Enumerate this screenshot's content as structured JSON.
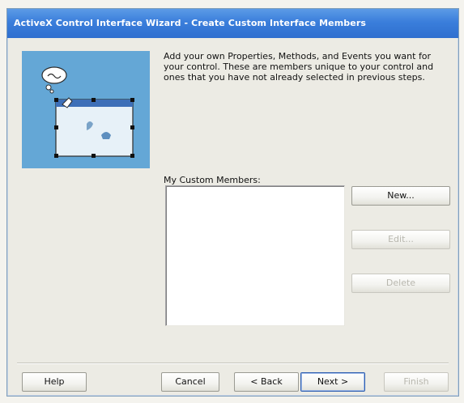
{
  "window": {
    "title": "ActiveX Control Interface Wizard - Create Custom Interface Members"
  },
  "art": {
    "icon": "wizard-illustration"
  },
  "description": "Add your own Properties, Methods, and Events you want for your control.  These are members unique to your control and ones that you have not already selected in previous steps.",
  "members": {
    "label": "My Custom Members:",
    "items": []
  },
  "buttons": {
    "new": "New...",
    "edit": "Edit...",
    "delete": "Delete",
    "help": "Help",
    "cancel": "Cancel",
    "back": "< Back",
    "next": "Next >",
    "finish": "Finish"
  },
  "colors": {
    "titlebar": "#3a7edb",
    "art_background": "#64a7d6"
  }
}
